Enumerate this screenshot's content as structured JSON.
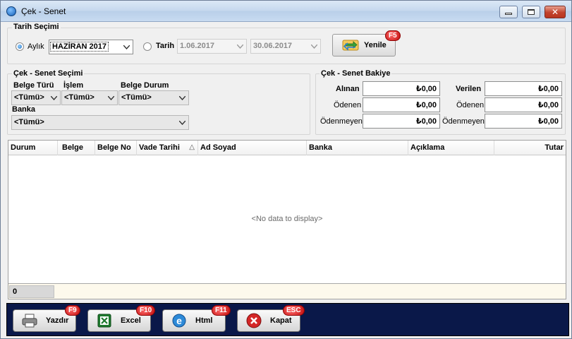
{
  "window": {
    "title": "Çek - Senet"
  },
  "date_group": {
    "title": "Tarih Seçimi",
    "monthly_label": "Aylık",
    "monthly_value": "HAZİRAN 2017",
    "date_label": "Tarih",
    "date_from": "1.06.2017",
    "date_to": "30.06.2017",
    "refresh_label": "Yenile",
    "refresh_key": "F5"
  },
  "selection_group": {
    "title": "Çek - Senet Seçimi",
    "doc_type_label": "Belge Türü",
    "doc_type_value": "<Tümü>",
    "operation_label": "İşlem",
    "operation_value": "<Tümü>",
    "doc_status_label": "Belge Durum",
    "doc_status_value": "<Tümü>",
    "bank_label": "Banka",
    "bank_value": "<Tümü>"
  },
  "balance_group": {
    "title": "Çek - Senet Bakiye",
    "received_label": "Alınan",
    "received_value": "₺0,00",
    "received_paid_label": "Ödenen",
    "received_paid_value": "₺0,00",
    "received_unpaid_label": "Ödenmeyen",
    "received_unpaid_value": "₺0,00",
    "given_label": "Verilen",
    "given_value": "₺0,00",
    "given_paid_label": "Ödenen",
    "given_paid_value": "₺0,00",
    "given_unpaid_label": "Ödenmeyen",
    "given_unpaid_value": "₺0,00"
  },
  "grid": {
    "columns": [
      "Durum",
      "Belge",
      "Belge No",
      "Vade Tarihi",
      "Ad Soyad",
      "Banka",
      "Açıklama",
      "Tutar"
    ],
    "sort_glyph": "△",
    "empty_text": "<No data to display>",
    "footer_count": "0"
  },
  "actions": {
    "print_label": "Yazdır",
    "print_key": "F9",
    "excel_label": "Excel",
    "excel_key": "F10",
    "html_label": "Html",
    "html_key": "F11",
    "close_label": "Kapat",
    "close_key": "ESC"
  },
  "colors": {
    "bottom_bar": "#0a1849",
    "key_badge": "#c30d0d",
    "grid_footer": "#fdf9ec"
  }
}
